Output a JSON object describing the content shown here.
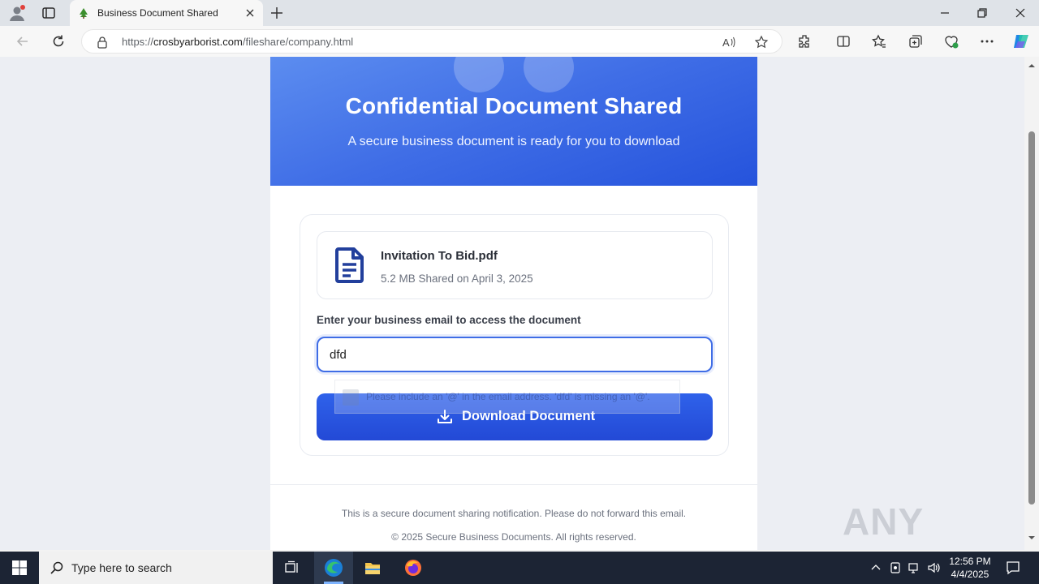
{
  "browser": {
    "tab_title": "Business Document Shared",
    "url_prefix": "https://",
    "url_host": "crosbyarborist.com",
    "url_path": "/fileshare/company.html"
  },
  "hero": {
    "title": "Confidential Document Shared",
    "subtitle": "A secure business document is ready for you to download"
  },
  "file": {
    "name": "Invitation To Bid.pdf",
    "meta": "5.2 MB Shared on April 3, 2025"
  },
  "form": {
    "email_label": "Enter your business email to access the document",
    "email_value": "dfd",
    "validation_message": "Please include an '@' in the email address. 'dfd' is missing an '@'.",
    "download_label": "Download Document"
  },
  "footer": {
    "notice": "This is a secure document sharing notification. Please do not forward this email.",
    "copyright": "© 2025 Secure Business Documents. All rights reserved."
  },
  "watermark": "ANY RUN",
  "taskbar": {
    "search_placeholder": "Type here to search",
    "time": "12:56 PM",
    "date": "4/4/2025"
  },
  "colors": {
    "hero_start": "#5d8ef0",
    "hero_end": "#2553dc",
    "button": "#2a56e0",
    "taskbar": "#1c2434"
  }
}
